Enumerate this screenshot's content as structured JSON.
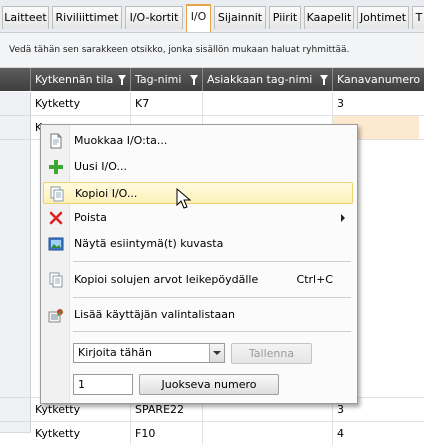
{
  "tabs": [
    {
      "label": "Laitteet"
    },
    {
      "label": "Riviliittimet"
    },
    {
      "label": "I/O-kortit"
    },
    {
      "label": "I/O",
      "active": true
    },
    {
      "label": "Sijainnit"
    },
    {
      "label": "Piirit"
    },
    {
      "label": "Kaapelit"
    },
    {
      "label": "Johtimet"
    },
    {
      "label": "T"
    }
  ],
  "group_panel": {
    "hint": "Vedä tähän sen sarakkeen otsikko, jonka sisällön mukaan haluat ryhmittää."
  },
  "grid": {
    "columns": [
      {
        "label": "Kytkennän tila"
      },
      {
        "label": "Tag-nimi"
      },
      {
        "label": "Asiakkaan tag-nimi"
      },
      {
        "label": "Kanavanumero"
      }
    ],
    "rows": [
      {
        "status": "Kytketty",
        "tag": "K7",
        "customer_tag": "",
        "channel": "3"
      },
      {
        "status": "K",
        "tag": "",
        "customer_tag": "",
        "channel": ""
      },
      {
        "status": "Kytketty",
        "tag": "SPARE22",
        "customer_tag": "",
        "channel": "3"
      },
      {
        "status": "Kytketty",
        "tag": "F10",
        "customer_tag": "",
        "channel": "4"
      }
    ]
  },
  "context_menu": {
    "items": [
      {
        "label": "Muokkaa I/O:ta...",
        "icon": "edit-document-icon"
      },
      {
        "label": "Uusi I/O...",
        "icon": "add-icon"
      },
      {
        "label": "Kopioi I/O...",
        "icon": "copy-icon"
      },
      {
        "label": "Poista",
        "icon": "delete-icon"
      },
      {
        "label": "Näytä esiintymä(t) kuvasta",
        "icon": "image-icon"
      },
      {
        "label": "Kopioi solujen arvot leikepöydälle",
        "icon": "clipboard-copy-icon",
        "shortcut": "Ctrl+C"
      },
      {
        "label": "Lisää käyttäjän valintalistaan",
        "icon": "user-list-icon"
      }
    ],
    "combo_placeholder": "Kirjoita tähän",
    "save_label": "Tallenna",
    "number_value": "1",
    "sequence_label": "Juokseva numero"
  },
  "colors": {
    "header_bg": "#4a4a4a",
    "active_tab_border": "#e6a54a",
    "hover_bg": "#fdf0b6",
    "highlight_cell": "#fde8d0"
  }
}
